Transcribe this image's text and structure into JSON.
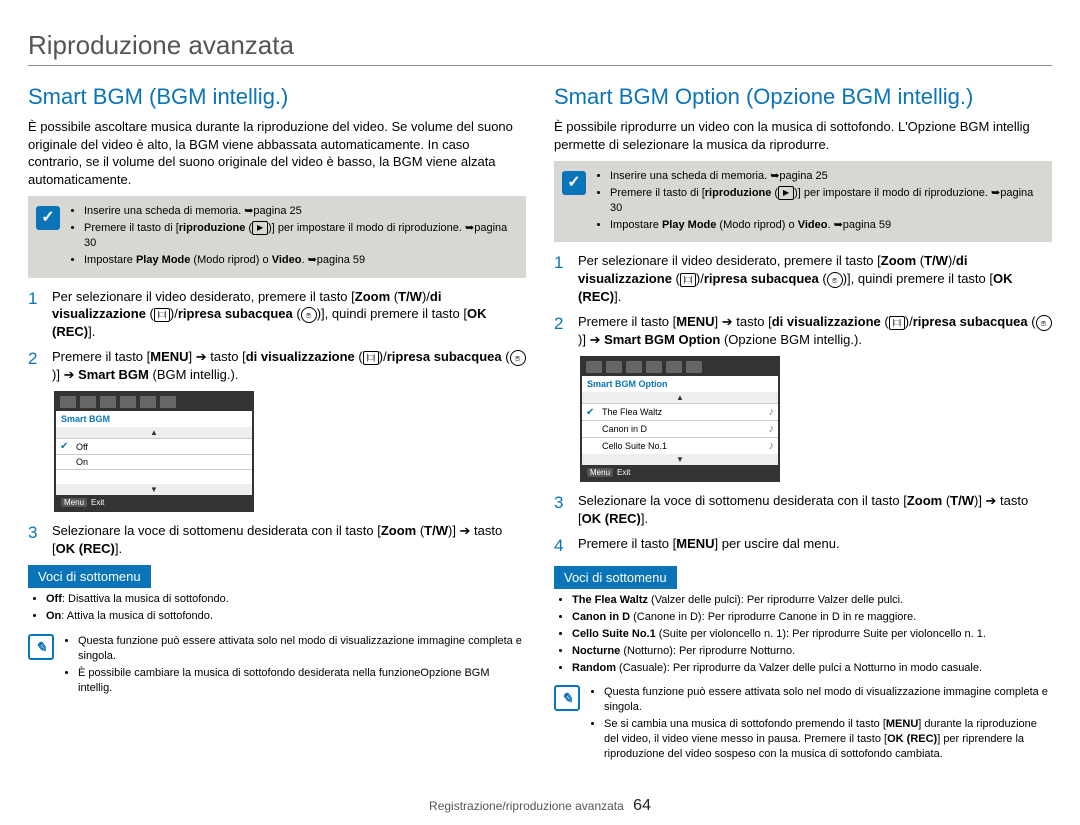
{
  "page_title": "Riproduzione avanzata",
  "footer": {
    "section": "Registrazione/riproduzione avanzata",
    "page": "64"
  },
  "left": {
    "heading": "Smart BGM (BGM intellig.)",
    "intro": "È possibile ascoltare musica durante la riproduzione del video. Se volume del suono originale del video è alto, la BGM viene abbassata automaticamente. In caso contrario, se il volume del suono originale del video è basso, la BGM viene alzata automaticamente.",
    "prereq": [
      {
        "text_a": "Inserire una scheda di memoria. ",
        "ref": "➥pagina 25"
      },
      {
        "text_a": "Premere il tasto di [",
        "bold": "riproduzione",
        "icon": "play",
        "text_b": "] per impostare il modo di riproduzione. ",
        "ref": "➥pagina 30"
      },
      {
        "text_a": "Impostare ",
        "bold": "Play Mode",
        "text_b": " (Modo riprod) o ",
        "bold2": "Video",
        "text_c": ". ",
        "ref": "➥pagina 59"
      }
    ],
    "steps": {
      "s1": {
        "pre": "Per selezionare il video desiderato, premere il tasto [",
        "zoom": "Zoom",
        "tw": "T/W",
        "sep": "/",
        "vis": "di visualizzazione",
        "vis_icon": "disp",
        "sep2": "/",
        "sub": "ripresa subacquea",
        "sub_icon": "under",
        "post": "], quindi premere il tasto [",
        "ok": "OK (REC)",
        "end": "]."
      },
      "s2": {
        "pre": "Premere il tasto [",
        "menu": "MENU",
        "arr": " ➔ tasto [",
        "vis": "di visualizzazione",
        "vis_icon": "disp",
        "sep": "/",
        "sub": "ripresa subacquea",
        "sub_icon": "under",
        "arr2": "] ➔ ",
        "target": "Smart BGM",
        "target_paren": " (BGM intellig.)."
      },
      "s3": {
        "pre": "Selezionare la voce di sottomenu desiderata con il tasto [",
        "zoom": "Zoom",
        "tw": "T/W",
        "arr": "] ➔ tasto [",
        "ok": "OK (REC)",
        "end": "]."
      }
    },
    "screenshot": {
      "title": "Smart BGM",
      "rows": [
        "Off",
        "On"
      ],
      "exit_btn": "Menu",
      "exit": "Exit"
    },
    "submenu_heading": "Voci di sottomenu",
    "submenu": [
      {
        "b": "Off",
        "t": ": Disattiva la musica di sottofondo."
      },
      {
        "b": "On",
        "t": ": Attiva la musica di sottofondo."
      }
    ],
    "notes": [
      "Questa funzione può essere attivata solo nel modo di visualizzazione immagine completa e singola.",
      "È possibile cambiare la musica di sottofondo desiderata nella funzioneOpzione BGM intellig."
    ]
  },
  "right": {
    "heading": "Smart BGM Option (Opzione BGM intellig.)",
    "intro": "È possibile riprodurre un video con la musica di sottofondo. L'Opzione BGM intellig permette di selezionare la musica da riprodurre.",
    "prereq": [
      {
        "text_a": "Inserire una scheda di memoria. ",
        "ref": "➥pagina 25"
      },
      {
        "text_a": "Premere il tasto di [",
        "bold": "riproduzione",
        "icon": "play",
        "text_b": "] per impostare il modo di riproduzione. ",
        "ref": "➥pagina 30"
      },
      {
        "text_a": "Impostare ",
        "bold": "Play Mode",
        "text_b": " (Modo riprod) o ",
        "bold2": "Video",
        "text_c": ". ",
        "ref": "➥pagina 59"
      }
    ],
    "steps": {
      "s1": {
        "pre": "Per selezionare il video desiderato, premere il tasto [",
        "zoom": "Zoom",
        "tw": "T/W",
        "sep": "/",
        "vis": "di visualizzazione",
        "vis_icon": "disp",
        "sep2": "/",
        "sub": "ripresa subacquea",
        "sub_icon": "under",
        "post": "], quindi premere il tasto [",
        "ok": "OK (REC)",
        "end": "]."
      },
      "s2": {
        "pre": "Premere il tasto [",
        "menu": "MENU",
        "arr": "] ➔ tasto [",
        "vis": "di visualizzazione",
        "vis_icon": "disp",
        "sep": "/",
        "sub": "ripresa subacquea",
        "sub_icon": "under",
        "arr2": "] ➔ ",
        "target": "Smart BGM Option",
        "target_paren": " (Opzione BGM intellig.)."
      },
      "s3": {
        "pre": "Selezionare la voce di sottomenu desiderata con il tasto [",
        "zoom": "Zoom",
        "tw": "T/W",
        "arr": "] ➔ tasto [",
        "ok": "OK (REC)",
        "end": "]."
      },
      "s4": {
        "pre": "Premere il tasto [",
        "menu": "MENU",
        "post": "] per uscire dal menu."
      }
    },
    "screenshot": {
      "title": "Smart BGM Option",
      "rows": [
        "The Flea Waltz",
        "Canon in D",
        "Cello Suite No.1"
      ],
      "exit_btn": "Menu",
      "exit": "Exit"
    },
    "submenu_heading": "Voci di sottomenu",
    "submenu": [
      {
        "b": "The Flea Waltz",
        "p": " (Valzer delle pulci)",
        "t": ": Per riprodurre Valzer delle pulci."
      },
      {
        "b": "Canon in D",
        "p": " (Canone in D)",
        "t": ": Per riprodurre Canone in D in re maggiore."
      },
      {
        "b": "Cello Suite No.1",
        "p": " (Suite per violoncello n. 1)",
        "t": ": Per riprodurre Suite per violoncello n. 1."
      },
      {
        "b": "Nocturne",
        "p": " (Notturno)",
        "t": ": Per riprodurre Notturno."
      },
      {
        "b": "Random",
        "p": " (Casuale)",
        "t": ": Per riprodurre da Valzer delle pulci a Notturno in modo casuale."
      }
    ],
    "notes": [
      {
        "t": "Questa funzione può essere attivata solo nel modo di visualizzazione immagine completa e singola."
      },
      {
        "pre": "Se si cambia una musica di sottofondo premendo il tasto [",
        "b1": "MENU",
        "mid": "] durante la riproduzione del video, il video viene messo in pausa. Premere il tasto [",
        "b2": "OK (REC)",
        "post": "] per riprendere la riproduzione del video sospeso con la musica di sottofondo cambiata."
      }
    ]
  }
}
